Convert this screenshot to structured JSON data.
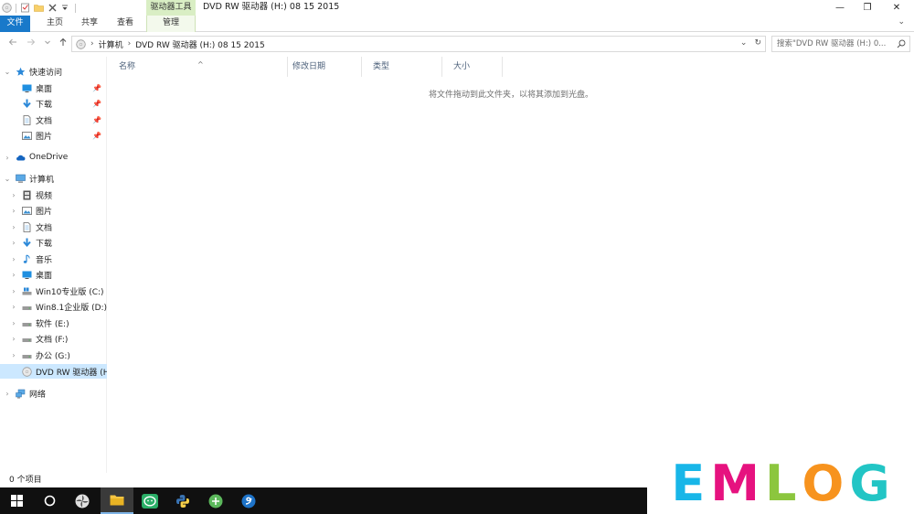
{
  "window": {
    "title": "DVD RW 驱动器 (H:) 08 15 2015",
    "context_tab_group": "驱动器工具",
    "controls": {
      "minimize": "—",
      "maximize": "❐",
      "close": "✕"
    }
  },
  "ribbon": {
    "tabs": [
      {
        "label": "文件"
      },
      {
        "label": "主页"
      },
      {
        "label": "共享"
      },
      {
        "label": "查看"
      },
      {
        "label": "管理"
      }
    ],
    "expand_glyph": "⌄"
  },
  "address": {
    "crumbs": [
      "计算机",
      "DVD RW 驱动器 (H:) 08 15 2015"
    ],
    "search_placeholder": "搜索\"DVD RW 驱动器 (H:) 0...",
    "separator": "›",
    "dropdown_glyph": "⌄",
    "refresh_glyph": "↻"
  },
  "sidebar": {
    "quick_access": {
      "label": "快速访问",
      "items": [
        {
          "label": "桌面",
          "icon": "desktop-icon"
        },
        {
          "label": "下载",
          "icon": "download-icon"
        },
        {
          "label": "文档",
          "icon": "document-icon"
        },
        {
          "label": "图片",
          "icon": "pictures-icon"
        }
      ]
    },
    "onedrive": {
      "label": "OneDrive"
    },
    "computer": {
      "label": "计算机",
      "items": [
        {
          "label": "视频",
          "icon": "video-icon"
        },
        {
          "label": "图片",
          "icon": "pictures-icon"
        },
        {
          "label": "文档",
          "icon": "document-icon"
        },
        {
          "label": "下载",
          "icon": "download-icon"
        },
        {
          "label": "音乐",
          "icon": "music-icon"
        },
        {
          "label": "桌面",
          "icon": "desktop-icon"
        },
        {
          "label": "Win10专业版 (C:)",
          "icon": "system-drive-icon"
        },
        {
          "label": "Win8.1企业版 (D:)",
          "icon": "drive-icon"
        },
        {
          "label": "软件 (E:)",
          "icon": "drive-icon"
        },
        {
          "label": "文档 (F:)",
          "icon": "drive-icon"
        },
        {
          "label": "办公 (G:)",
          "icon": "drive-icon"
        },
        {
          "label": "DVD RW 驱动器 (H:",
          "icon": "dvd-drive-icon"
        }
      ]
    },
    "network": {
      "label": "网络"
    }
  },
  "content": {
    "columns": [
      "名称",
      "修改日期",
      "类型",
      "大小"
    ],
    "empty_message": "将文件拖动到此文件夹，以将其添加到光盘。"
  },
  "status": {
    "items_count": "0 个项目"
  },
  "taskbar": {
    "items": [
      "start-icon",
      "cortana-icon",
      "pinwheel-app-icon",
      "file-explorer-icon",
      "wechat-icon",
      "python-icon",
      "green-app-icon",
      "blue-browser-icon"
    ]
  },
  "watermark": {
    "letters": [
      {
        "char": "E",
        "color": "#18b6e8"
      },
      {
        "char": "M",
        "color": "#e6127f"
      },
      {
        "char": "L",
        "color": "#8cc63e"
      },
      {
        "char": "O",
        "color": "#f7931e"
      },
      {
        "char": "G",
        "color": "#22c5c5"
      }
    ]
  }
}
